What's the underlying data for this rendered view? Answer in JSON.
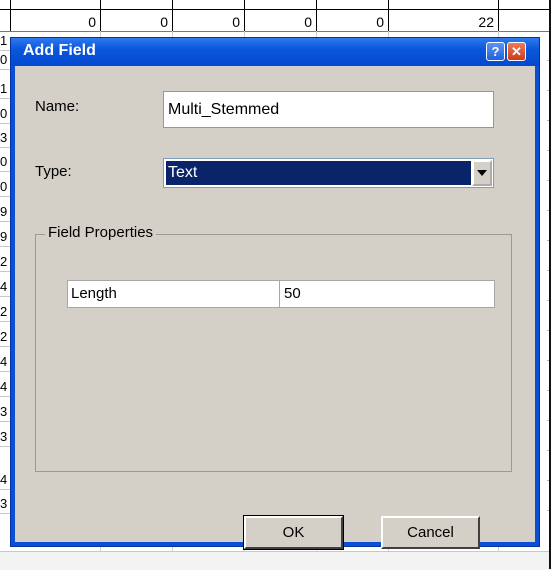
{
  "sheet": {
    "first_row_values": [
      "0",
      "0",
      "0",
      "0",
      "0",
      "22"
    ],
    "row_numbers": [
      "1",
      "0",
      "1",
      "0",
      "3",
      "0",
      "0",
      "9",
      "9",
      "2",
      "4",
      "2",
      "2",
      "4",
      "4",
      "3",
      "3",
      "4",
      "3"
    ]
  },
  "dialog": {
    "title": "Add Field",
    "help_label": "?",
    "close_label": "✕",
    "name_label": "Name:",
    "name_value": "Multi_Stemmed",
    "type_label": "Type:",
    "type_value": "Text",
    "group_title": "Field Properties",
    "properties": [
      {
        "key": "Length",
        "value": "50"
      }
    ],
    "ok_label": "OK",
    "cancel_label": "Cancel"
  },
  "colors": {
    "title_bar": "#0a57db",
    "dialog_face": "#d4d0c8",
    "selection": "#0a246a",
    "close_button": "#cf3b18"
  },
  "icons": [
    "help-icon",
    "close-icon",
    "dropdown-arrow-icon"
  ]
}
